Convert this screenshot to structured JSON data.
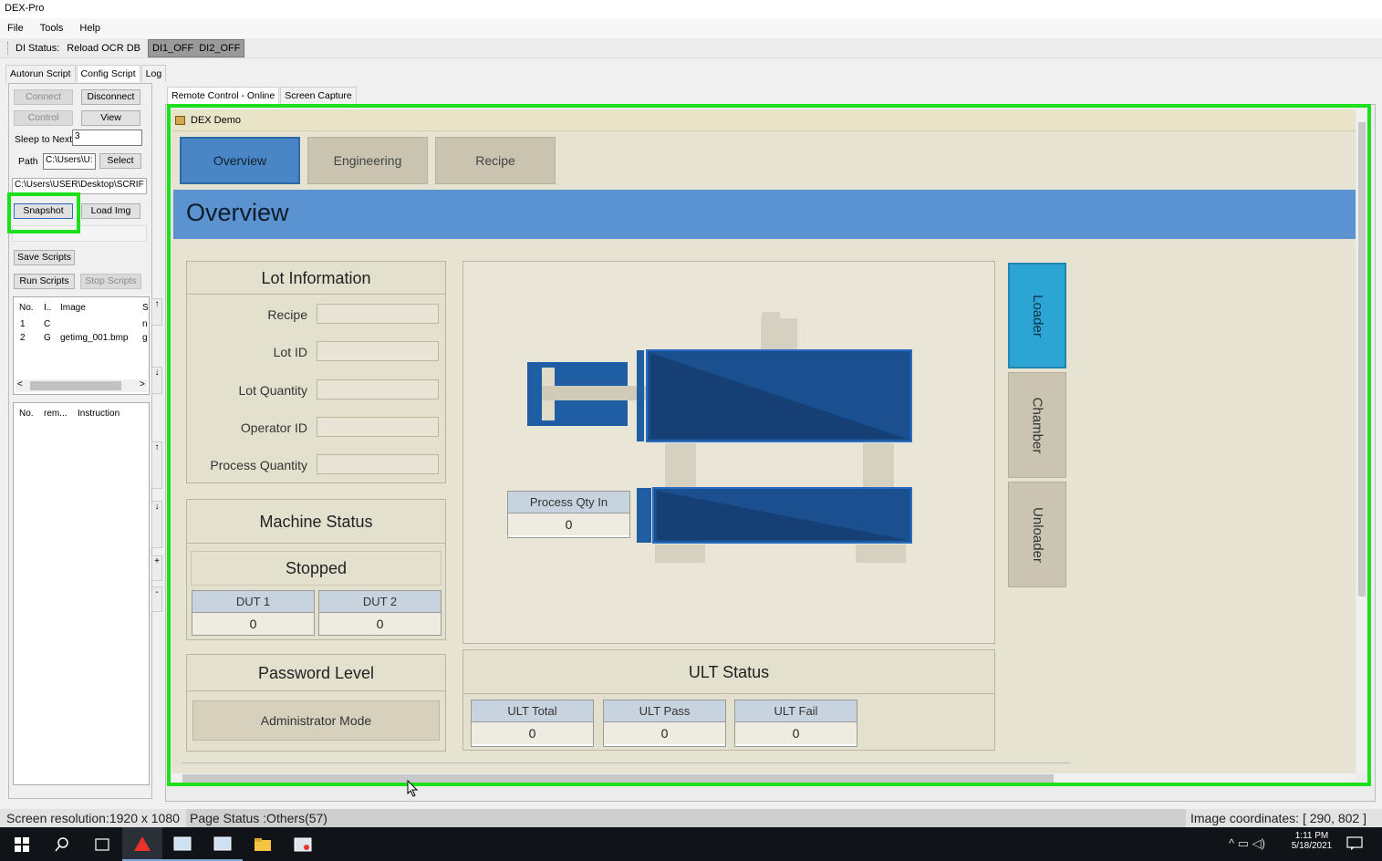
{
  "app": {
    "title": "DEX-Pro"
  },
  "menu": {
    "file": "File",
    "tools": "Tools",
    "help": "Help"
  },
  "toolbar": {
    "di_status": "DI Status:",
    "reload": "Reload OCR DB",
    "di1": "DI1_OFF",
    "di2": "DI2_OFF"
  },
  "left_tabs": [
    "Autorun Script",
    "Config Script",
    "Log"
  ],
  "left": {
    "connect": "Connect",
    "disconnect": "Disconnect",
    "control": "Control",
    "view": "View",
    "sleep_label": "Sleep to Next",
    "sleep_value": "3",
    "path_label": "Path",
    "path_value": "C:\\Users\\U:",
    "select": "Select",
    "full_path": "C:\\Users\\USER\\Desktop\\SCRIF",
    "snapshot": "Snapshot",
    "load_img": "Load Img",
    "save_scripts": "Save Scripts",
    "run_scripts": "Run Scripts",
    "stop_scripts": "Stop Scripts",
    "list1_headers": [
      "No.",
      "I..",
      "Image",
      "S"
    ],
    "list1_rows": [
      [
        "1",
        "C",
        "",
        "n"
      ],
      [
        "2",
        "G",
        "getimg_001.bmp",
        "g"
      ]
    ],
    "list2_headers": [
      "No.",
      "rem...",
      "Instruction"
    ],
    "scroll_up": "↑",
    "scroll_down": "↓",
    "plus": "+",
    "minus": "-"
  },
  "remote_tabs": [
    "Remote Control - Online",
    "Screen Capture"
  ],
  "dex": {
    "window_title": "DEX Demo",
    "tabs": [
      "Overview",
      "Engineering",
      "Recipe"
    ],
    "header": "Overview",
    "lot": {
      "title": "Lot Information",
      "fields": [
        "Recipe",
        "Lot ID",
        "Lot Quantity",
        "Operator ID",
        "Process Quantity"
      ]
    },
    "machine": {
      "title": "Machine Status",
      "state": "Stopped",
      "dut1_label": "DUT 1",
      "dut1_value": "0",
      "dut2_label": "DUT 2",
      "dut2_value": "0"
    },
    "password": {
      "title": "Password Level",
      "mode": "Administrator Mode"
    },
    "process_qty": {
      "label": "Process Qty In",
      "value": "0"
    },
    "ult": {
      "title": "ULT Status",
      "total_label": "ULT Total",
      "total_value": "0",
      "pass_label": "ULT Pass",
      "pass_value": "0",
      "fail_label": "ULT Fail",
      "fail_value": "0"
    },
    "side_tabs": [
      "Loader",
      "Chamber",
      "Unloader"
    ]
  },
  "status": {
    "resolution": "Screen resolution:1920 x 1080",
    "page_status": "Page Status :Others(57)",
    "coords": "Image coordinates: [ 290, 802 ]"
  },
  "taskbar": {
    "time": "1:11 PM",
    "date": "5/18/2021"
  },
  "colors": {
    "highlight": "#1be01b",
    "dex_blue": "#5a93cf",
    "loader_active": "#2da5d4"
  }
}
